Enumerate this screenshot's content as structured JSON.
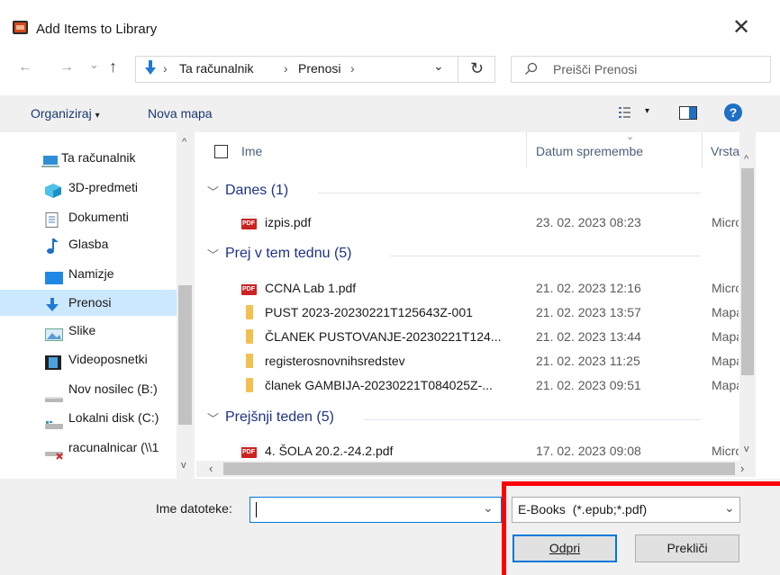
{
  "window": {
    "title": "Add Items to Library",
    "close_glyph": "✕"
  },
  "nav": {
    "back": "←",
    "forward": "→",
    "recent": "⌄",
    "up": "↑",
    "path": [
      "Ta računalnik",
      "Prenosi"
    ],
    "sep": "›",
    "dropdown": "⌄",
    "refresh": "↻",
    "search_placeholder": "Preišči Prenosi"
  },
  "toolbar": {
    "organize": "Organiziraj",
    "organize_caret": "▾",
    "new_folder": "Nova mapa",
    "view_caret": "▾",
    "help": "?"
  },
  "sidebar": {
    "items": [
      {
        "label": "Ta računalnik",
        "icon": "computer-icon"
      },
      {
        "label": "3D-predmeti",
        "icon": "3d-objects-icon"
      },
      {
        "label": "Dokumenti",
        "icon": "documents-icon"
      },
      {
        "label": "Glasba",
        "icon": "music-icon"
      },
      {
        "label": "Namizje",
        "icon": "desktop-icon"
      },
      {
        "label": "Prenosi",
        "icon": "downloads-icon",
        "selected": true
      },
      {
        "label": "Slike",
        "icon": "pictures-icon"
      },
      {
        "label": "Videoposnetki",
        "icon": "videos-icon"
      },
      {
        "label": "Nov nosilec (B:)",
        "icon": "drive-icon"
      },
      {
        "label": "Lokalni disk (C:)",
        "icon": "local-disk-icon"
      },
      {
        "label": "racunalnicar (\\\\1",
        "icon": "network-drive-icon"
      }
    ]
  },
  "columns": {
    "name": "Ime",
    "date": "Datum spremembe",
    "type": "Vrsta"
  },
  "groups": [
    {
      "label": "Danes (1)",
      "files": [
        {
          "name": "izpis.pdf",
          "date": "23. 02. 2023 08:23",
          "type": "Micro",
          "kind": "pdf"
        }
      ]
    },
    {
      "label": "Prej v tem tednu (5)",
      "files": [
        {
          "name": "CCNA Lab 1.pdf",
          "date": "21. 02. 2023 12:16",
          "type": "Micro",
          "kind": "pdf"
        },
        {
          "name": "PUST 2023-20230221T125643Z-001",
          "date": "21. 02. 2023 13:57",
          "type": "Mapa",
          "kind": "folder"
        },
        {
          "name": "ČLANEK PUSTOVANJE-20230221T124...",
          "date": "21. 02. 2023 13:44",
          "type": "Mapa",
          "kind": "folder"
        },
        {
          "name": "registerosnovnihsredstev",
          "date": "21. 02. 2023 11:25",
          "type": "Mapa",
          "kind": "folder"
        },
        {
          "name": "članek GAMBIJA-20230221T084025Z-...",
          "date": "21. 02. 2023 09:51",
          "type": "Mapa",
          "kind": "folder"
        }
      ]
    },
    {
      "label": "Prejšnji teden (5)",
      "files": [
        {
          "name": "4. ŠOLA 20.2.-24.2.pdf",
          "date": "17. 02. 2023 09:08",
          "type": "Micro",
          "kind": "pdf"
        }
      ]
    }
  ],
  "footer": {
    "filename_label": "Ime datoteke:",
    "filename_value": "",
    "filter_value": "E-Books  (*.epub;*.pdf)",
    "open": "Odpri",
    "cancel": "Prekliči"
  },
  "colors": {
    "accent": "#0078d7",
    "highlight": "#ff0000",
    "group_text": "#1e3287",
    "selected_bg": "#cce8ff"
  }
}
